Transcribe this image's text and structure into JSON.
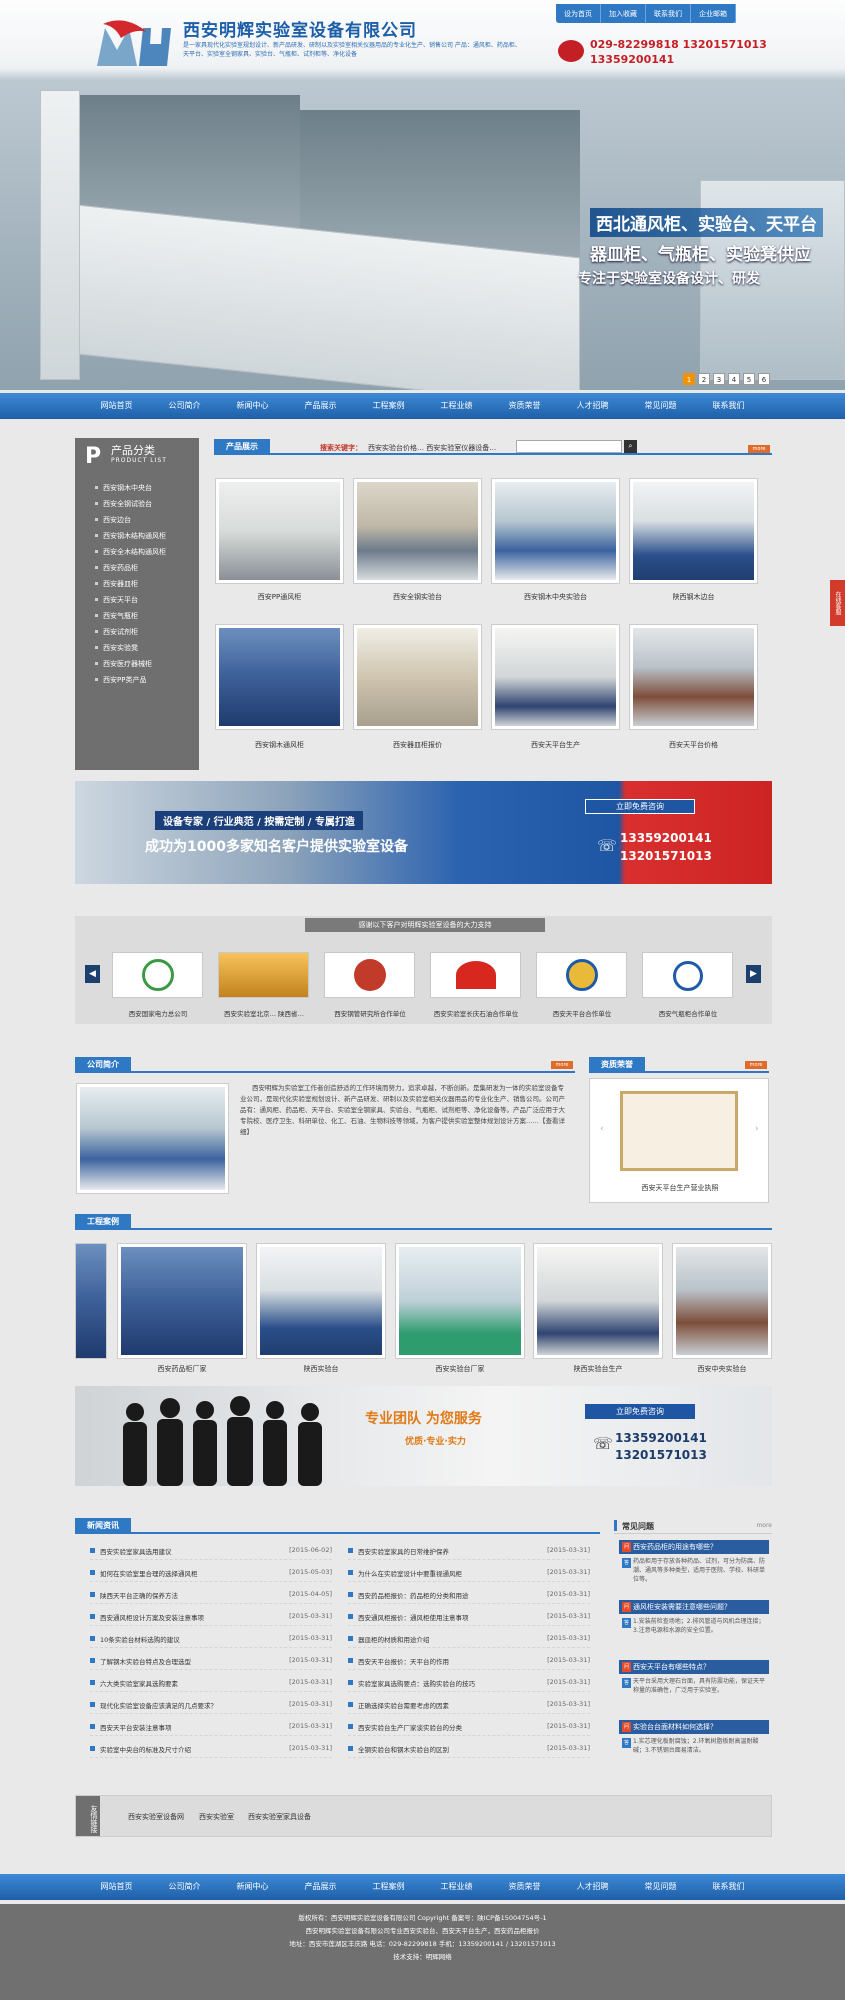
{
  "header": {
    "company": "西安明辉实验室设备有限公司",
    "desc": "是一家具现代化实验室规划设计、新产品研发、研制以及实验室相关仪器用品的专业化生产、销售公司 产品：通风柜、药品柜、天平台、实验室全钢家具、实验台、气瓶柜、试剂柜等、净化设备",
    "top_links": [
      "设为首页",
      "加入收藏",
      "联系我们",
      "企业邮箱"
    ],
    "phones": [
      "029-82299818 13201571013",
      "13359200141"
    ],
    "slogan_line1": "西北通风柜、实验台、天平台",
    "slogan_line2": "器皿柜、气瓶柜、实验凳供应",
    "slogan_line3": "专注于实验室设备设计、研发",
    "slide_nums": [
      "1",
      "2",
      "3",
      "4",
      "5",
      "6"
    ]
  },
  "nav": [
    "网站首页",
    "公司简介",
    "新闻中心",
    "产品展示",
    "工程案例",
    "工程业绩",
    "资质荣誉",
    "人才招聘",
    "常见问题",
    "联系我们"
  ],
  "sidebar": {
    "big": "P",
    "title": "产品分类",
    "subtitle": "PRODUCT LIST",
    "items": [
      "西安钢木中央台",
      "西安全钢试验台",
      "西安边台",
      "西安钢木结构通风柜",
      "西安全木结构通风柜",
      "西安药品柜",
      "西安器皿柜",
      "西安天平台",
      "西安气瓶柜",
      "西安试剂柜",
      "西安实验凳",
      "西安医疗器械柜",
      "西安PP类产品"
    ]
  },
  "products": {
    "title": "产品展示",
    "search_label": "搜索关键字：",
    "search_hot": "西安实验台价格… 西安实验室仪器设备…",
    "more": "more",
    "items": [
      "西安PP通风柜",
      "西安全钢实验台",
      "西安钢木中央实验台",
      "陕西钢木边台",
      "西安钢木通风柜",
      "西安器皿柜报价",
      "西安天平台生产",
      "西安天平台价格"
    ]
  },
  "banner1": {
    "tags": "设备专家 / 行业典范 / 按需定制 / 专属打造",
    "main": "成功为1000多家知名客户提供实验室设备",
    "consult": "立即免费咨询",
    "phone1": "13359200141",
    "phone2": "13201571013"
  },
  "clients": {
    "title": "感谢以下客户对明辉实验室设备的大力支持",
    "prev": "◀",
    "next": "▶",
    "items": [
      "西安国家电力总公司",
      "西安实验室北京… 陕西省…",
      "西安钢管研究所合作单位",
      "西安实验室长庆石油合作单位",
      "西安天平台合作单位",
      "西安气瓶柜合作单位"
    ]
  },
  "about": {
    "title": "公司简介",
    "text": "西安明辉为实验室工作者创造舒适的工作环境而努力，追求卓越，不断创新。是集研发为一体的实验室设备专业公司，是现代化实验室规划设计、新产品研发、研制以及实验室相关仪器用品的专业化生产、销售公司。公司产品有：通风柜、药品柜、天平台、实验室全钢家具、实验台、气瓶柜、试剂柜等、净化设备等。产品广泛应用于大专院校、医疗卫生、科研单位、化工、石油、生物科技等领域，为客户提供实验室整体规划设计方案……【查看详细】",
    "more": "more"
  },
  "honor": {
    "title": "资质荣誉",
    "caption": "西安天平台生产营业执照",
    "more": "more"
  },
  "cases": {
    "title": "工程案例",
    "items": [
      "西安药品柜厂家",
      "陕西实验台",
      "西安实验台厂家",
      "陕西实验台生产",
      "西安中央实验台"
    ]
  },
  "banner2": {
    "main": "专业团队 为您服务",
    "sub": "优质·专业·实力",
    "consult": "立即免费咨询",
    "phone1": "13359200141",
    "phone2": "13201571013"
  },
  "news": {
    "title": "新闻资讯",
    "left": [
      [
        "西安实验室家具选用建议",
        "[2015-06-02]"
      ],
      [
        "如何在实验室里合理的选择通风柜",
        "[2015-05-03]"
      ],
      [
        "陕西天平台正确的保养方法",
        "[2015-04-05]"
      ],
      [
        "西安通风柜设计方案及安装注意事项",
        "[2015-03-31]"
      ],
      [
        "10条实验台材料选购的建议",
        "[2015-03-31]"
      ],
      [
        "了解钢木实验台特点及合理选型",
        "[2015-03-31]"
      ],
      [
        "六大类实验室家具选购要素",
        "[2015-03-31]"
      ],
      [
        "现代化实验室设备应该满足的几点要求？",
        "[2015-03-31]"
      ],
      [
        "西安天平台安装注意事项",
        "[2015-03-31]"
      ],
      [
        "实验室中央台的标准及尺寸介绍",
        "[2015-03-31]"
      ]
    ],
    "right": [
      [
        "西安实验室家具的日常维护保养",
        "[2015-03-31]"
      ],
      [
        "为什么在实验室设计中要重视通风柜",
        "[2015-03-31]"
      ],
      [
        "西安药品柜报价：药品柜的分类和用途",
        "[2015-03-31]"
      ],
      [
        "西安通风柜报价：通风柜使用注意事项",
        "[2015-03-31]"
      ],
      [
        "器皿柜的材质和用途介绍",
        "[2015-03-31]"
      ],
      [
        "西安天平台报价：天平台的作用",
        "[2015-03-31]"
      ],
      [
        "实验室家具选购要点：选购实验台的技巧",
        "[2015-03-31]"
      ],
      [
        "正确选择实验台需要考虑的因素",
        "[2015-03-31]"
      ],
      [
        "西安实验台生产厂家谈实验台的分类",
        "[2015-03-31]"
      ],
      [
        "全钢实验台和钢木实验台的区别",
        "[2015-03-31]"
      ]
    ],
    "more": "more"
  },
  "faq": {
    "title": "常见问题",
    "more": "more",
    "items": [
      {
        "q": "西安药品柜的用途有哪些？",
        "a": "药品柜用于存放各种药品、试剂，可分为防腐、防潮、通风等多种类型，适用于医院、学校、科研单位等。"
      },
      {
        "q": "通风柜安装需要注意哪些问题？",
        "a": "1.安装前检查场地；2.排风管道与风机合理连接；3.注意电源和水源的安全位置。"
      },
      {
        "q": "西安天平台有哪些特点？",
        "a": "天平台采用大理石台面，具有防震功能，保证天平称量的准确性，广泛用于实验室。"
      },
      {
        "q": "实验台台面材料如何选择？",
        "a": "1.实芯理化板耐腐蚀；2.环氧树脂板耐高温耐酸碱；3.不锈钢台面易清洁。"
      }
    ]
  },
  "links": {
    "title": "友情链接",
    "items": [
      "西安实验室设备网",
      "西安实验室",
      "西安实验室家具设备"
    ]
  },
  "footer": {
    "nav": [
      "网站首页",
      "公司简介",
      "新闻中心",
      "产品展示",
      "工程案例",
      "工程业绩",
      "资质荣誉",
      "人才招聘",
      "常见问题",
      "联系我们"
    ],
    "line1": "版权所有：西安明辉实验室设备有限公司 Copyright 备案号：陕ICP备15004754号-1",
    "line2": "西安明辉实验室设备有限公司专业西安实验台、西安天平台生产，西安药品柜报价",
    "line3": "地址：西安市莲湖区丰庆路 电话：029-82299818 手机：13359200141 / 13201571013",
    "line4": "技术支持：明辉网络"
  }
}
